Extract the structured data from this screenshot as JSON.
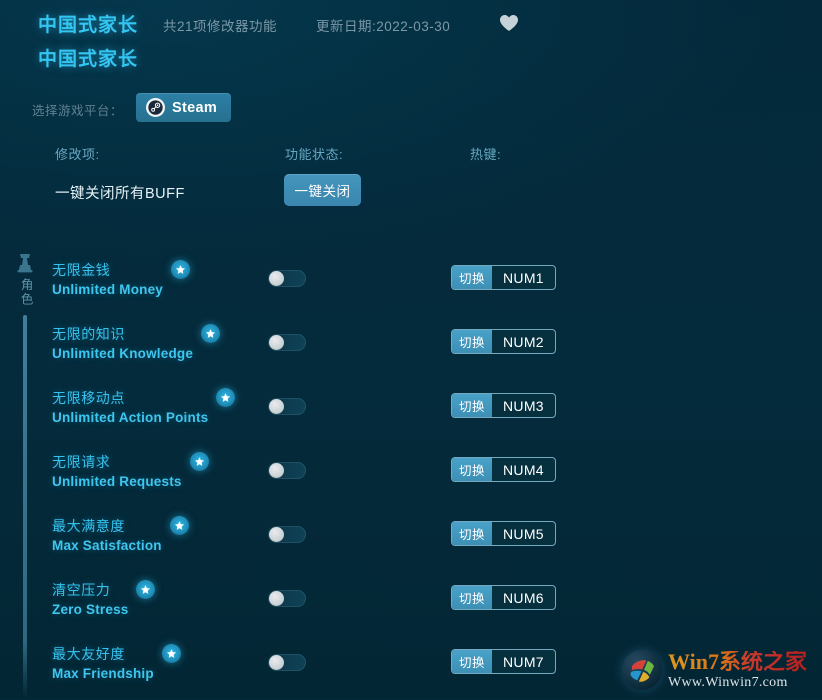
{
  "header": {
    "game_title": "中国式家长",
    "game_subtitle": "中国式家长",
    "feature_count": "共21项修改器功能",
    "update_date": "更新日期:2022-03-30",
    "favorite_icon": "heart-icon"
  },
  "platform": {
    "label": "选择游戏平台：",
    "selected": "Steam",
    "icon": "steam-icon"
  },
  "columns": {
    "cheat": "修改项:",
    "status": "功能状态:",
    "hotkey": "热键:"
  },
  "all_off": {
    "label": "一键关闭所有BUFF",
    "button": "一键关闭"
  },
  "category": {
    "icon": "character-icon",
    "label": "角色"
  },
  "colors": {
    "background": "#03293a",
    "accent_cyan": "#36c2ee",
    "button_blue": "#3d8fb5",
    "muted_text": "#7b98a6"
  },
  "rows": [
    {
      "cn": "无限金钱",
      "en": "Unlimited Money",
      "star": "star-badge-icon",
      "toggle": "off",
      "hk_action": "切换",
      "hk_key": "NUM1"
    },
    {
      "cn": "无限的知识",
      "en": "Unlimited Knowledge",
      "star": "star-badge-icon",
      "toggle": "off",
      "hk_action": "切换",
      "hk_key": "NUM2"
    },
    {
      "cn": "无限移动点",
      "en": "Unlimited Action Points",
      "star": "star-badge-icon",
      "toggle": "off",
      "hk_action": "切换",
      "hk_key": "NUM3"
    },
    {
      "cn": "无限请求",
      "en": "Unlimited Requests",
      "star": "star-badge-icon",
      "toggle": "off",
      "hk_action": "切换",
      "hk_key": "NUM4"
    },
    {
      "cn": "最大满意度",
      "en": "Max Satisfaction",
      "star": "star-badge-icon",
      "toggle": "off",
      "hk_action": "切换",
      "hk_key": "NUM5"
    },
    {
      "cn": "清空压力",
      "en": "Zero Stress",
      "star": "star-badge-icon",
      "toggle": "off",
      "hk_action": "切换",
      "hk_key": "NUM6"
    },
    {
      "cn": "最大友好度",
      "en": "Max Friendship",
      "star": "star-badge-icon",
      "toggle": "off",
      "hk_action": "切换",
      "hk_key": "NUM7"
    }
  ],
  "watermark": {
    "brand": "Win7系统之家",
    "url": "Www.Winwin7.com",
    "icon": "windows-logo-icon"
  }
}
